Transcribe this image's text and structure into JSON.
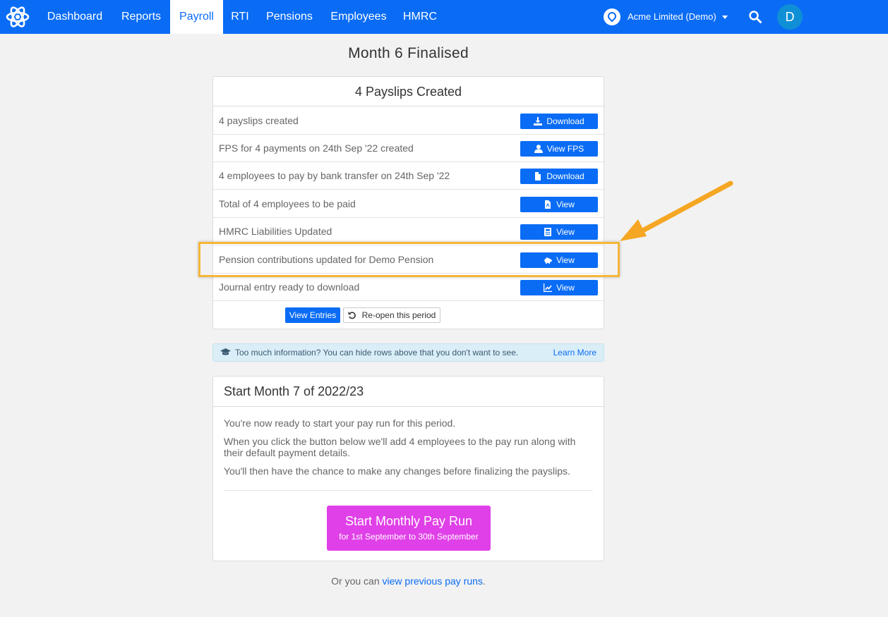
{
  "nav": {
    "items": [
      "Dashboard",
      "Reports",
      "Payroll",
      "RTI",
      "Pensions",
      "Employees",
      "HMRC"
    ],
    "active": "Payroll",
    "company": "Acme Limited (Demo)",
    "avatar_letter": "D"
  },
  "page_title": "Month 6 Finalised",
  "summary": {
    "title": "4 Payslips Created",
    "rows": [
      {
        "label": "4 payslips created",
        "button": "Download",
        "icon": "download-icon"
      },
      {
        "label": "FPS for 4 payments on 24th Sep '22 created",
        "button": "View FPS",
        "icon": "user-icon"
      },
      {
        "label": "4 employees to pay by bank transfer on 24th Sep '22",
        "button": "Download",
        "icon": "file-icon"
      },
      {
        "label": "Total of 4 employees to be paid",
        "button": "View",
        "icon": "pdf-file-icon"
      },
      {
        "label": "HMRC Liabilities Updated",
        "button": "View",
        "icon": "calculator-icon"
      },
      {
        "label": "Pension contributions updated for Demo Pension",
        "button": "View",
        "icon": "piggy-bank-icon"
      },
      {
        "label": "Journal entry ready to download",
        "button": "View",
        "icon": "chart-icon"
      }
    ],
    "view_entries": "View Entries",
    "reopen": "Re-open this period"
  },
  "info": {
    "message": "Too much information? You can hide rows above that you don't want to see.",
    "learn_more": "Learn More"
  },
  "start": {
    "title": "Start Month 7 of 2022/23",
    "p1": "You're now ready to start your pay run for this period.",
    "p2": "When you click the button below we'll add 4 employees to the pay run along with their default payment details.",
    "p3": "You'll then have the chance to make any changes before finalizing the payslips.",
    "button_main": "Start Monthly Pay Run",
    "button_sub": "for 1st September to 30th September"
  },
  "footer": {
    "prefix": "Or you can",
    "link": "view previous pay runs",
    "suffix": "."
  },
  "colors": {
    "brand": "#0a6cf5",
    "start_button": "#e040e8",
    "highlight": "#f5b63a",
    "info_bg": "#daeef8"
  }
}
